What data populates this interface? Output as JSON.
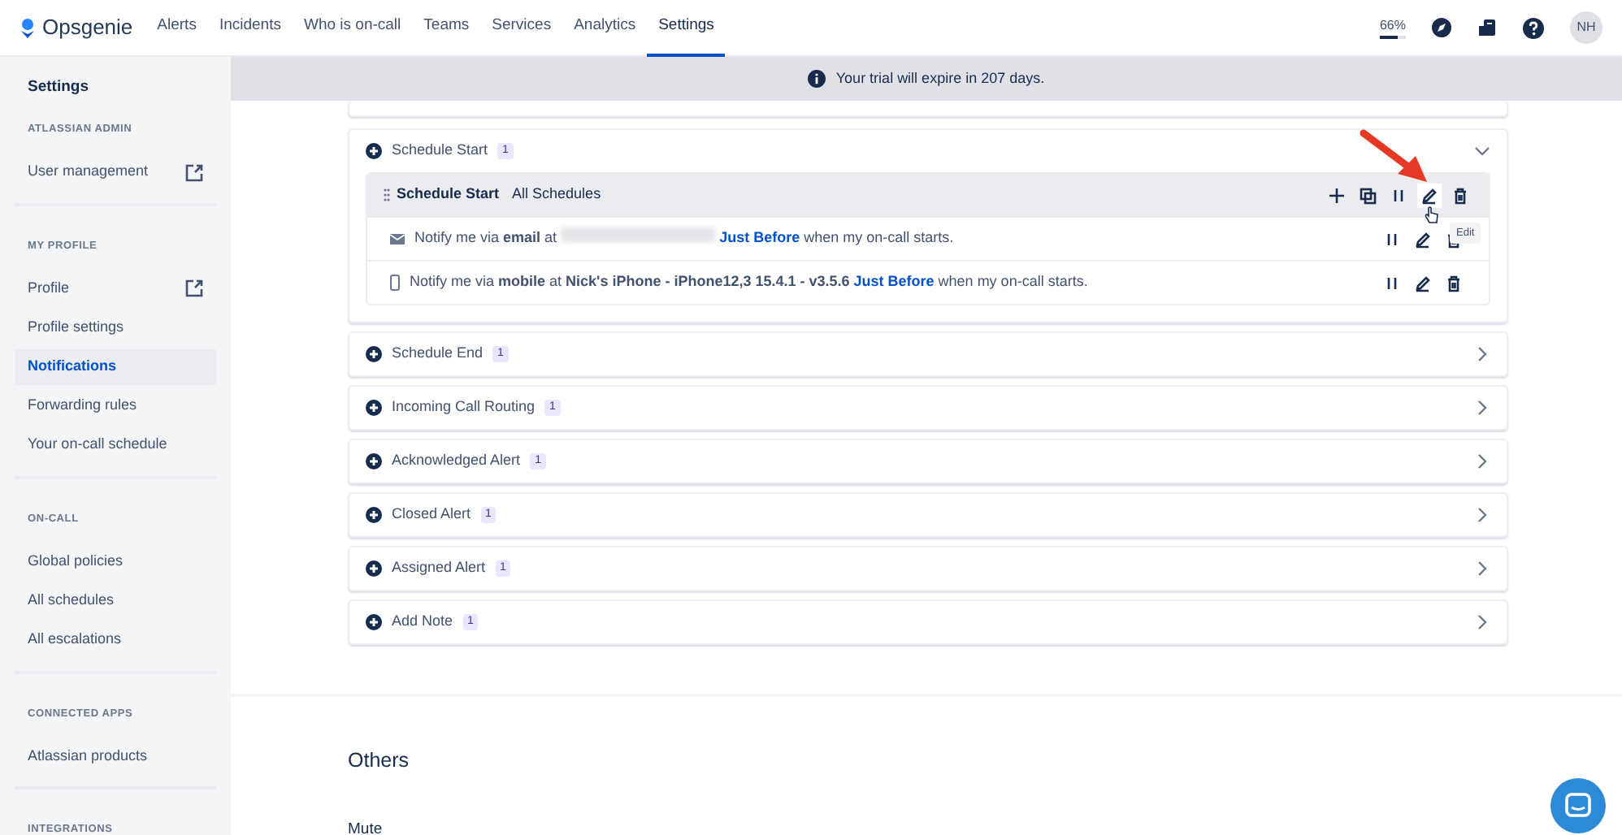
{
  "topnav": {
    "brand": "Opsgenie",
    "items": [
      {
        "label": "Alerts",
        "selected": false
      },
      {
        "label": "Incidents",
        "selected": false
      },
      {
        "label": "Who is on-call",
        "selected": false
      },
      {
        "label": "Teams",
        "selected": false
      },
      {
        "label": "Services",
        "selected": false
      },
      {
        "label": "Analytics",
        "selected": false
      },
      {
        "label": "Settings",
        "selected": true
      }
    ],
    "usage": {
      "reading": "66%",
      "level": 0.66
    },
    "avatar": "NH"
  },
  "sidebar": {
    "title": "Settings",
    "groups": [
      {
        "header": "ATLASSIAN ADMIN",
        "items": [
          {
            "label": "User management",
            "external": true,
            "selected": false
          }
        ]
      },
      {
        "header": "MY PROFILE",
        "items": [
          {
            "label": "Profile",
            "external": true,
            "selected": false
          },
          {
            "label": "Profile settings",
            "external": false,
            "selected": false
          },
          {
            "label": "Notifications",
            "external": false,
            "selected": true
          },
          {
            "label": "Forwarding rules",
            "external": false,
            "selected": false
          },
          {
            "label": "Your on-call schedule",
            "external": false,
            "selected": false
          }
        ]
      },
      {
        "header": "ON-CALL",
        "items": [
          {
            "label": "Global policies",
            "external": false,
            "selected": false
          },
          {
            "label": "All schedules",
            "external": false,
            "selected": false
          },
          {
            "label": "All escalations",
            "external": false,
            "selected": false
          }
        ]
      },
      {
        "header": "CONNECTED APPS",
        "items": [
          {
            "label": "Atlassian products",
            "external": false,
            "selected": false
          }
        ]
      },
      {
        "header": "INTEGRATIONS"
      }
    ]
  },
  "banner": "Your trial will expire in 207 days.",
  "sections": [
    {
      "title": "Schedule Start",
      "count": "1",
      "expanded": true,
      "rule_group": {
        "title": "Schedule Start",
        "scope": "All Schedules",
        "tooltip": "Edit",
        "rules": [
          {
            "kind": "email",
            "prefix": "Notify me via **email** at",
            "redacted": true,
            "timing": "Just Before",
            "suffix": "when my on-call starts."
          },
          {
            "kind": "mobile",
            "prefix": "Notify me via **mobile** at **Nick's iPhone - iPhone12,3 15.4.1 - v3.5.6**",
            "redacted": false,
            "timing": "Just Before",
            "suffix": "when my on-call starts."
          }
        ]
      }
    },
    {
      "title": "Schedule End",
      "count": "1",
      "expanded": false
    },
    {
      "title": "Incoming Call Routing",
      "count": "1",
      "expanded": false
    },
    {
      "title": "Acknowledged Alert",
      "count": "1",
      "expanded": false
    },
    {
      "title": "Closed Alert",
      "count": "1",
      "expanded": false
    },
    {
      "title": "Assigned Alert",
      "count": "1",
      "expanded": false
    },
    {
      "title": "Add Note",
      "count": "1",
      "expanded": false
    }
  ],
  "others": {
    "title": "Others",
    "subtitle": "Mute"
  }
}
